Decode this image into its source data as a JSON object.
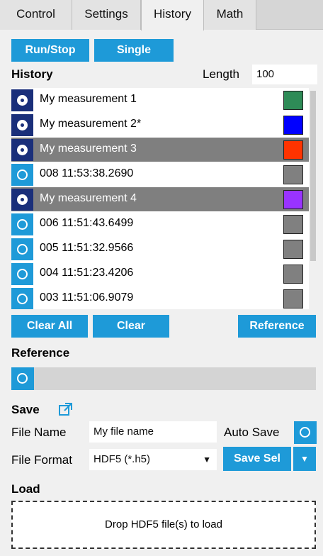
{
  "tabs": [
    "Control",
    "Settings",
    "History",
    "Math"
  ],
  "buttons": {
    "run_stop": "Run/Stop",
    "single": "Single",
    "clear_all": "Clear All",
    "clear": "Clear",
    "reference": "Reference",
    "save_sel": "Save Sel",
    "dropdown_arrow": "▼"
  },
  "history": {
    "title": "History",
    "length_label": "Length",
    "length_value": "100",
    "items": [
      {
        "label": "My measurement 1",
        "color": "#2e8b57",
        "radio": "checked",
        "selected": false
      },
      {
        "label": "My measurement 2*",
        "color": "#0000ff",
        "radio": "checked",
        "selected": false
      },
      {
        "label": "My measurement 3",
        "color": "#ff3300",
        "radio": "checked",
        "selected": true
      },
      {
        "label": "008 11:53:38.2690",
        "color": "#808080",
        "radio": "unchecked",
        "selected": false
      },
      {
        "label": "My measurement 4",
        "color": "#9933ff",
        "radio": "checked",
        "selected": true
      },
      {
        "label": "006 11:51:43.6499",
        "color": "#808080",
        "radio": "unchecked",
        "selected": false
      },
      {
        "label": "005 11:51:32.9566",
        "color": "#808080",
        "radio": "unchecked",
        "selected": false
      },
      {
        "label": "004 11:51:23.4206",
        "color": "#808080",
        "radio": "unchecked",
        "selected": false
      },
      {
        "label": "003 11:51:06.9079",
        "color": "#808080",
        "radio": "unchecked",
        "selected": false
      }
    ]
  },
  "reference": {
    "title": "Reference"
  },
  "save": {
    "title": "Save",
    "file_name_label": "File Name",
    "file_name_value": "My file name",
    "auto_save_label": "Auto Save",
    "file_format_label": "File Format",
    "file_format_value": "HDF5 (*.h5)",
    "select_arrow": "▼"
  },
  "load": {
    "title": "Load",
    "drop_text": "Drop HDF5 file(s) to load"
  },
  "colors": {
    "accent": "#1e9ad8",
    "dark_radio": "#1a2f7a",
    "selected_row": "#7f7f7f"
  }
}
